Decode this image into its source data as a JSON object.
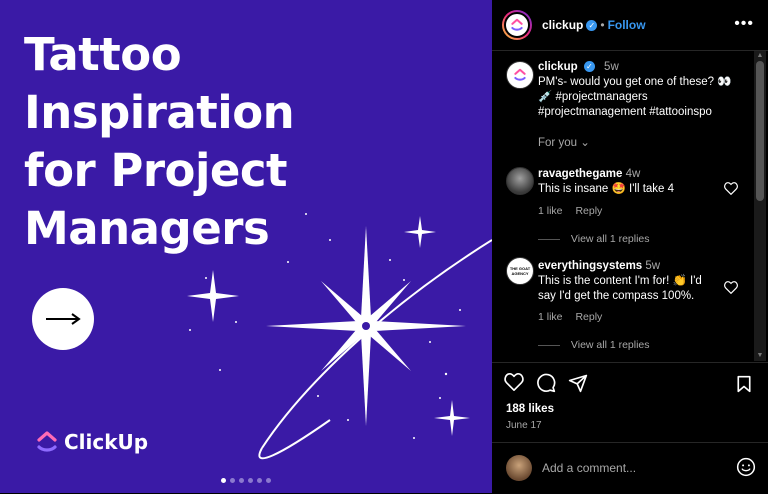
{
  "post": {
    "headline_lines": [
      "Tattoo",
      "Inspiration",
      "for Project",
      "Managers"
    ],
    "brand_name": "ClickUp",
    "carousel": {
      "count": 6,
      "active": 1
    }
  },
  "header": {
    "username": "clickup",
    "separator": "•",
    "follow_label": "Follow",
    "more_label": "•••"
  },
  "caption": {
    "username": "clickup",
    "age": "5w",
    "text_line1": "PM's- would you get one of these? 👀",
    "text_line2": "💉 #projectmanagers",
    "text_line3": "#projectmanagement #tattooinspo",
    "for_you_label": "For you"
  },
  "comments": [
    {
      "username": "ravagethegame",
      "age": "4w",
      "text": "This is insane 🤩 I'll take 4",
      "likes": "1 like",
      "reply_label": "Reply",
      "view_replies": "View all 1 replies"
    },
    {
      "username": "everythingsystems",
      "age": "5w",
      "text_line1": "This is the content I'm for! 👏 I'd",
      "text_line2": "say I'd get the compass 100%.",
      "likes": "1 like",
      "reply_label": "Reply",
      "view_replies": "View all 1 replies",
      "avatar_text": "THE GOAT AGENCY"
    }
  ],
  "actions": {
    "likes": "188 likes",
    "date": "June 17"
  },
  "add_comment": {
    "placeholder": "Add a comment..."
  },
  "colors": {
    "media_bg": "#3a1aa6",
    "follow": "#3897f0",
    "verified": "#3897f0"
  }
}
